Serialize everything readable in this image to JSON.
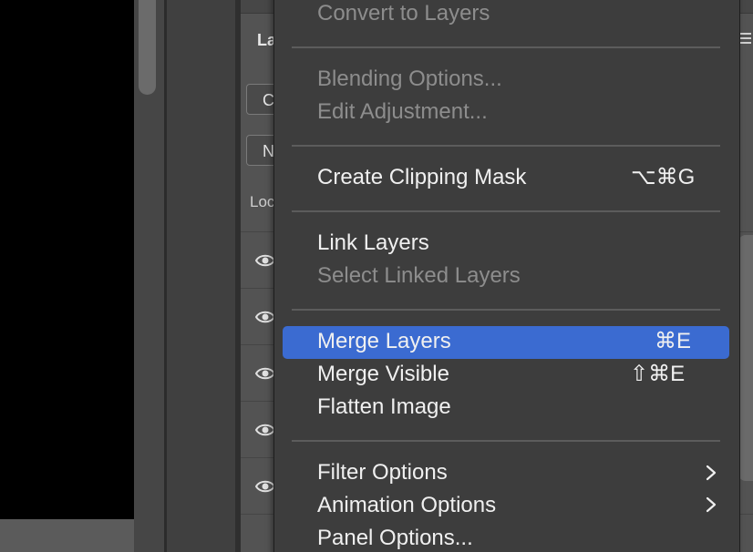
{
  "layers_panel": {
    "tab_label": "La",
    "filter_box_text": "C",
    "blend_mode_text": "N",
    "lock_label": "Loc"
  },
  "context_menu": {
    "items": [
      {
        "label": "Convert to Layers",
        "enabled": false,
        "shortcut": ""
      },
      {
        "label": "Blending Options...",
        "enabled": false,
        "shortcut": ""
      },
      {
        "label": "Edit Adjustment...",
        "enabled": false,
        "shortcut": ""
      },
      {
        "label": "Create Clipping Mask",
        "enabled": true,
        "shortcut": "⌥⌘G"
      },
      {
        "label": "Link Layers",
        "enabled": true,
        "shortcut": ""
      },
      {
        "label": "Select Linked Layers",
        "enabled": false,
        "shortcut": ""
      },
      {
        "label": "Merge Layers",
        "enabled": true,
        "shortcut": "⌘E",
        "highlighted": true
      },
      {
        "label": "Merge Visible",
        "enabled": true,
        "shortcut": "⇧⌘E"
      },
      {
        "label": "Flatten Image",
        "enabled": true,
        "shortcut": ""
      },
      {
        "label": "Filter Options",
        "enabled": true,
        "submenu": true
      },
      {
        "label": "Animation Options",
        "enabled": true,
        "submenu": true
      },
      {
        "label": "Panel Options...",
        "enabled": true,
        "shortcut": ""
      }
    ]
  },
  "colors": {
    "highlight": "#3b6bd1",
    "menu_bg": "#3d3d3d",
    "disabled_text": "#8d8d8d"
  }
}
